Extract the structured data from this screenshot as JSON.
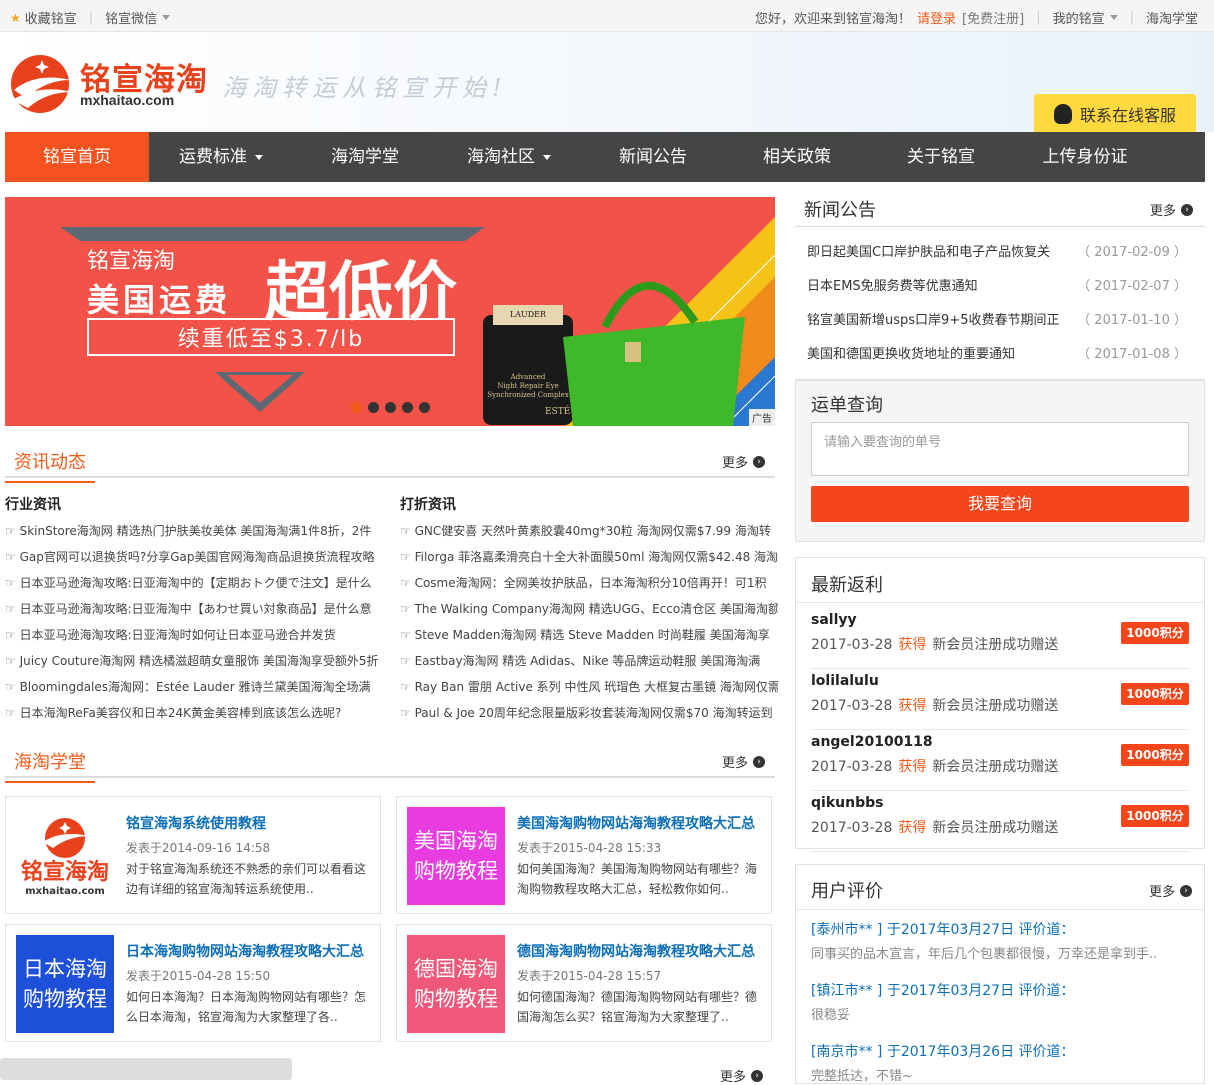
{
  "topbar": {
    "bookmark": "收藏铭宣",
    "wechat": "铭宣微信",
    "welcome": "您好，欢迎来到铭宣海淘！",
    "login": "请登录",
    "register": "[免费注册]",
    "my": "我的铭宣",
    "school": "海淘学堂"
  },
  "header": {
    "logo_cn": "铭宣海淘",
    "logo_en": "mxhaitao.com",
    "slogan": "海淘转运从铭宣开始!",
    "cs_button": "联系在线客服"
  },
  "nav": [
    {
      "label": "铭宣首页",
      "active": true,
      "dropdown": false
    },
    {
      "label": "运费标准",
      "active": false,
      "dropdown": true
    },
    {
      "label": "海淘学堂",
      "active": false,
      "dropdown": false
    },
    {
      "label": "海淘社区",
      "active": false,
      "dropdown": true
    },
    {
      "label": "新闻公告",
      "active": false,
      "dropdown": false
    },
    {
      "label": "相关政策",
      "active": false,
      "dropdown": false
    },
    {
      "label": "关于铭宣",
      "active": false,
      "dropdown": false
    },
    {
      "label": "上传身份证",
      "active": false,
      "dropdown": false
    }
  ],
  "banner": {
    "brand": "铭宣海淘",
    "line1": "美国运费",
    "line1_big": "超低价",
    "line2": "续重低至$3.7/lb",
    "ad_tag": "广告",
    "jar_text": [
      "Advanced",
      "Night Repair Eye",
      "Synchronized Complex"
    ],
    "lid_text": "LAUDER",
    "jar_base": "ESTÉ",
    "slides": 5,
    "active_slide": 0
  },
  "news_section": {
    "title": "资讯动态",
    "more": "更多",
    "industry": {
      "title": "行业资讯",
      "items": [
        "SkinStore海淘网 精选热门护肤美妆美体 美国海淘满1件8折，2件",
        "Gap官网可以退换货吗?分享Gap美国官网海淘商品退换货流程攻略",
        "日本亚马逊海淘攻略:日亚海淘中的【定期おトク便で注文】是什么",
        "日本亚马逊海淘攻略:日亚海淘中【あわせ買い対象商品】是什么意",
        "日本亚马逊海淘攻略:日亚海淘时如何让日本亚马逊合并发货",
        "Juicy Couture海淘网 精选橘滋超萌女童服饰 美国海淘享受额外5折",
        "Bloomingdales海淘网：Estée Lauder 雅诗兰黛美国海淘全场满",
        "日本海淘ReFa美容仪和日本24K黄金美容棒到底该怎么选呢?"
      ]
    },
    "discount": {
      "title": "打折资讯",
      "items": [
        "GNC健安喜 天然叶黄素胶囊40mg*30粒 海淘网仅需$7.99 海淘转",
        "Filorga 菲洛嘉柔滑亮白十全大补面膜50ml 海淘网仅需$42.48 海淘",
        "Cosme海淘网：全网美妆护肤品，日本海淘积分10倍再开！可1积",
        "The Walking Company海淘网 精选UGG、Ecco清仓区 美国海淘额",
        "Steve Madden海淘网 精选 Steve Madden 时尚鞋履 美国海淘享",
        "Eastbay海淘网 精选 Adidas、Nike 等品牌运动鞋服 美国海淘满",
        "Ray Ban 雷朋 Active 系列 中性风 玳瑁色 大框复古墨镜 海淘网仅需",
        "Paul & Joe 20周年纪念限量版彩妆套装海淘网仅需$70 海淘转运到"
      ]
    }
  },
  "school_section": {
    "title": "海淘学堂",
    "more": "更多",
    "cards": [
      {
        "thumb": "铭宣海淘",
        "thumb_sub": "mxhaitao.com",
        "color": "#ffffff",
        "title": "铭宣海淘系统使用教程",
        "date": "发表于2014-09-16 14:58",
        "desc": "对于铭宣海淘系统还不熟悉的亲们可以看看这边有详细的铭宣海淘转运系统使用.."
      },
      {
        "thumb": "美国海淘购物教程",
        "thumb_sub": "",
        "color": "#e83ce0",
        "title": "美国海淘购物网站海淘教程攻略大汇总",
        "date": "发表于2015-04-28 15:33",
        "desc": "如何美国海淘？美国海淘购物网站有哪些？海淘购物教程攻略大汇总，轻松教你如何.."
      },
      {
        "thumb": "日本海淘购物教程",
        "thumb_sub": "",
        "color": "#1e4fd8",
        "title": "日本海淘购物网站海淘教程攻略大汇总",
        "date": "发表于2015-04-28 15:50",
        "desc": "如何日本海淘？日本海淘购物网站有哪些？怎么日本海淘，铭宣海淘为大家整理了各.."
      },
      {
        "thumb": "德国海淘购物教程",
        "thumb_sub": "",
        "color": "#f0587a",
        "title": "德国海淘购物网站海淘教程攻略大汇总",
        "date": "发表于2015-04-28 15:57",
        "desc": "如何德国海淘？德国海淘购物网站有哪些？德国海淘怎么买？铭宣海淘为大家整理了.."
      }
    ],
    "bottom_more": "更多"
  },
  "announce": {
    "title": "新闻公告",
    "more": "更多",
    "items": [
      {
        "text": "即日起美国C口岸护肤品和电子产品恢复关",
        "date": "（ 2017-02-09 ）"
      },
      {
        "text": "日本EMS免服务费等优惠通知",
        "date": "（ 2017-02-07 ）"
      },
      {
        "text": "铭宣美国新增usps口岸9+5收费春节期间正",
        "date": "（ 2017-01-10 ）"
      },
      {
        "text": "美国和德国更换收货地址的重要通知",
        "date": "（ 2017-01-08 ）"
      }
    ]
  },
  "tracking": {
    "title": "运单查询",
    "placeholder": "请输入要查询的单号",
    "button": "我要查询"
  },
  "rebates": {
    "title": "最新返利",
    "gain": "获得",
    "items": [
      {
        "user": "sallyy",
        "date": "2017-03-28",
        "reason": "新会员注册成功赠送",
        "points": "1000积分"
      },
      {
        "user": "lolilalulu",
        "date": "2017-03-28",
        "reason": "新会员注册成功赠送",
        "points": "1000积分"
      },
      {
        "user": "angel20100118",
        "date": "2017-03-28",
        "reason": "新会员注册成功赠送",
        "points": "1000积分"
      },
      {
        "user": "qikunbbs",
        "date": "2017-03-28",
        "reason": "新会员注册成功赠送",
        "points": "1000积分"
      }
    ]
  },
  "reviews": {
    "title": "用户评价",
    "more": "更多",
    "items": [
      {
        "head": "[泰州市** ] 于2017年03月27日 评价道：",
        "body": "同事买的品木宣言，年后几个包裹都很慢，万幸还是拿到手.."
      },
      {
        "head": "[镇江市** ] 于2017年03月27日 评价道：",
        "body": "很稳妥"
      },
      {
        "head": "[南京市** ] 于2017年03月26日 评价道：",
        "body": "完整抵达，不错~"
      }
    ]
  },
  "colors": {
    "accent": "#f25b1a",
    "nav_bg": "#454545",
    "link": "#0d6fb8",
    "banner_bg": "#f25248"
  },
  "icons": [
    "star-icon",
    "caret-down-icon",
    "qq-icon",
    "more-arrow-icon",
    "hand-pointer-icon"
  ]
}
